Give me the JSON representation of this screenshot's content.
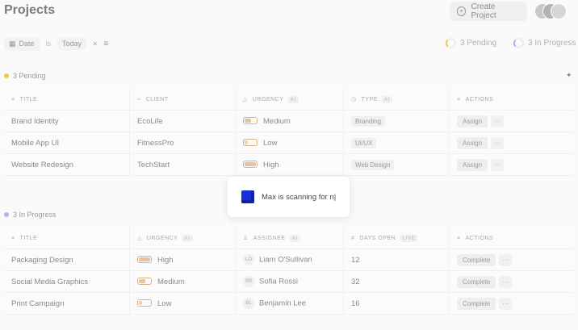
{
  "header": {
    "title": "Projects",
    "create_label": "Create Project",
    "create_icon": "plus-circle-icon"
  },
  "filters": {
    "date_label": "Date",
    "op_label": "is",
    "value_label": "Today",
    "clear": "×",
    "menu_icon": "list-icon"
  },
  "status_summary": {
    "pending": "3 Pending",
    "in_progress": "3 In Progress"
  },
  "pending_section": {
    "label": "3 Pending",
    "dot_color": "#f2c94c",
    "columns": [
      "TITLE",
      "CLIENT",
      "URGENCY",
      "TYPE",
      "ACTIONS"
    ],
    "ai_badge": "AI",
    "rows": [
      {
        "title": "Brand Identity",
        "client": "EcoLife",
        "urgency": "Medium",
        "type": "Branding",
        "action": "Assign",
        "more": "···"
      },
      {
        "title": "Mobile App UI",
        "client": "FitnessPro",
        "urgency": "Low",
        "type": "UI/UX",
        "action": "Assign",
        "more": "···"
      },
      {
        "title": "Website Redesign",
        "client": "TechStart",
        "urgency": "High",
        "type": "Web Design",
        "action": "Assign",
        "more": "···"
      }
    ]
  },
  "progress_section": {
    "label": "3 In Progress",
    "dot_color": "#b7a9f2",
    "columns": [
      "TITLE",
      "URGENCY",
      "ASSIGNEE",
      "DAYS OPEN",
      "ACTIONS"
    ],
    "ai_badge": "AI",
    "live_badge": "LIVE",
    "rows": [
      {
        "title": "Packaging Design",
        "urgency": "High",
        "initials": "LO",
        "assignee": "Liam O'Sullivan",
        "days": "12",
        "action": "Complete",
        "more": "···"
      },
      {
        "title": "Social Media Graphics",
        "urgency": "Medium",
        "initials": "SR",
        "assignee": "Sofia Rossi",
        "days": "32",
        "action": "Complete",
        "more": "···"
      },
      {
        "title": "Print Campaign",
        "urgency": "Low",
        "initials": "BL",
        "assignee": "Benjamin Lee",
        "days": "16",
        "action": "Complete",
        "more": "···"
      }
    ]
  },
  "scan_popup": {
    "text": "Max is scanning for n|",
    "icon": "cube-icon",
    "icon_color": "#1a2fd6"
  }
}
